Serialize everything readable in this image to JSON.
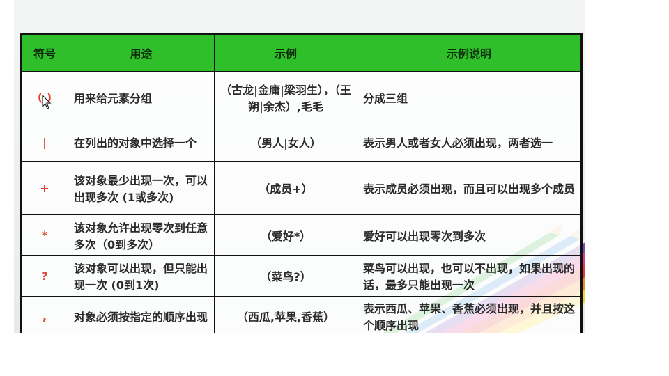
{
  "table": {
    "headers": [
      "符号",
      "用途",
      "示例",
      "示例说明"
    ],
    "rows": [
      {
        "symbol": "( )",
        "use": "用来给元素分组",
        "example": "（古龙|金庸|梁羽生），（王朔|余杰）,毛毛",
        "desc": "分成三组"
      },
      {
        "symbol": "|",
        "use": "在列出的对象中选择一个",
        "example": "（男人|女人）",
        "desc": "表示男人或者女人必须出现，两者选一"
      },
      {
        "symbol": "+",
        "use": "该对象最少出现一次，可以出现多次 (1或多次)",
        "example": "（成员+）",
        "desc": "表示成员必须出现，而且可以出现多个成员"
      },
      {
        "symbol": "*",
        "use": "该对象允许出现零次到任意多次（0到多次）",
        "example": "（爱好*）",
        "desc": "爱好可以出现零次到多次"
      },
      {
        "symbol": "?",
        "use": "该对象可以出现，但只能出现一次 (0到1次)",
        "example": "（菜鸟?）",
        "desc": "菜鸟可以出现，也可以不出现，如果出现的话，最多只能出现一次"
      },
      {
        "symbol": ",",
        "use": "对象必须按指定的顺序出现",
        "example": "（西瓜,苹果,香蕉）",
        "desc": "表示西瓜、苹果、香蕉必须出现，并且按这个顺序出现"
      }
    ]
  },
  "colors": {
    "header_bg": "#2fbf2a",
    "symbol": "#e0402a"
  },
  "icons": {
    "cursor": "mouse-pointer-icon",
    "decoration": "colored-pencils"
  }
}
